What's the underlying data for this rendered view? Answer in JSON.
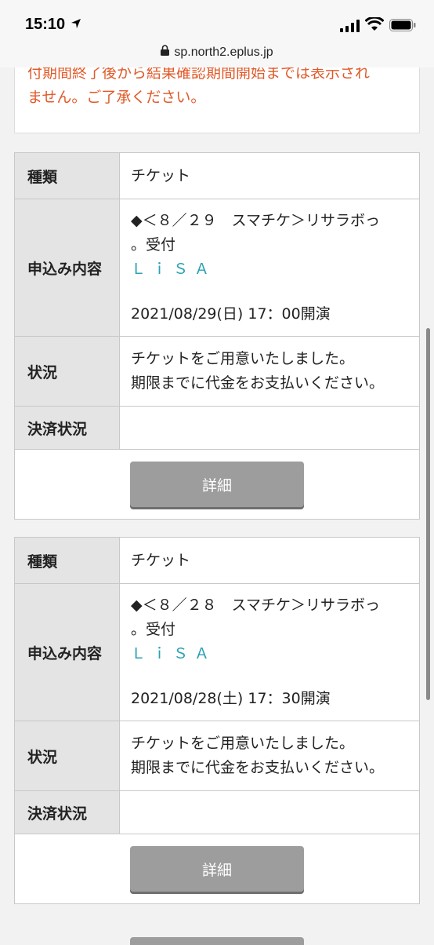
{
  "status": {
    "time": "15:10"
  },
  "browser": {
    "url": "sp.north2.eplus.jp"
  },
  "notice": {
    "line1": "付期間終了後から結果確認期間開始までは表示され",
    "line2": "ません。ご了承ください。"
  },
  "labels": {
    "type": "種類",
    "content": "申込み内容",
    "status": "状況",
    "payment": "決済状況",
    "detail": "詳細"
  },
  "entries": [
    {
      "type": "チケット",
      "title1": "◆＜８／２９　スマチケ＞リサラボっ",
      "title2": "。受付",
      "artist": "ＬｉＳＡ",
      "date": "2021/08/29(日) 17：00開演",
      "status1": "チケットをご用意いたしました。",
      "status2": "期限までに代金をお支払いください。",
      "payment": ""
    },
    {
      "type": "チケット",
      "title1": "◆＜８／２８　スマチケ＞リサラボっ",
      "title2": "。受付",
      "artist": "ＬｉＳＡ",
      "date": "2021/08/28(土) 17：30開演",
      "status1": "チケットをご用意いたしました。",
      "status2": "期限までに代金をお支払いください。",
      "payment": ""
    }
  ]
}
